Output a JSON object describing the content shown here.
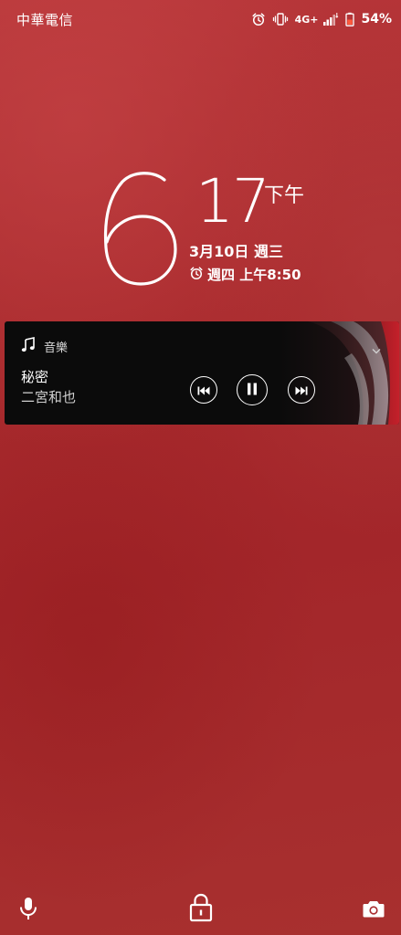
{
  "status_bar": {
    "carrier": "中華電信",
    "network": "4G+",
    "battery_percent": "54%",
    "icons": [
      "alarm-icon",
      "vibrate-icon",
      "signal-icon",
      "battery-icon"
    ]
  },
  "clock": {
    "hour": "6",
    "minute": "17",
    "ampm": "下午",
    "date": "3月10日 週三",
    "next_alarm": "週四 上午8:50"
  },
  "music": {
    "app_name": "音樂",
    "song_title": "秘密",
    "artist": "二宮和也",
    "icons": [
      "music-note-icon",
      "chevron-down-icon",
      "previous-track-icon",
      "pause-icon",
      "next-track-icon"
    ]
  },
  "bottom_shortcuts": {
    "icons": [
      "microphone-icon",
      "lock-icon",
      "camera-icon"
    ]
  },
  "colors": {
    "background": "#a82a2d",
    "card": "#0b0b0b",
    "text": "#ffffff",
    "battery_low": "#ff5a3c"
  }
}
